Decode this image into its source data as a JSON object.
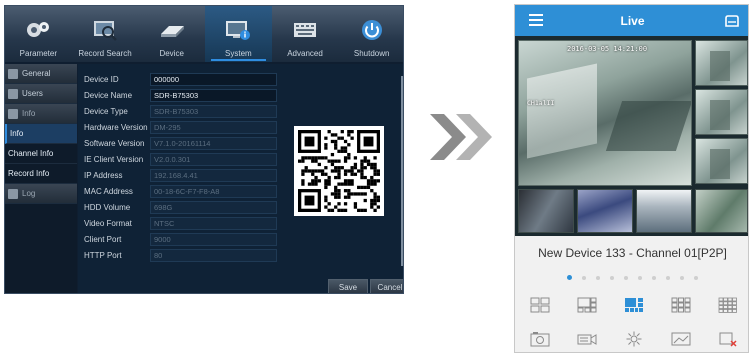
{
  "dvr": {
    "tabs": [
      {
        "label": "Parameter",
        "icon": "gears-icon"
      },
      {
        "label": "Record Search",
        "icon": "magnifier-video-icon"
      },
      {
        "label": "Device",
        "icon": "hard-drive-icon"
      },
      {
        "label": "System",
        "icon": "monitor-info-icon",
        "active": true
      },
      {
        "label": "Advanced",
        "icon": "keyboard-icon"
      },
      {
        "label": "Shutdown",
        "icon": "power-icon"
      }
    ],
    "sidebar": {
      "general": "General",
      "users": "Users",
      "info_group": "Info",
      "info": "Info",
      "channel_info": "Channel Info",
      "record_info": "Record Info",
      "log": "Log"
    },
    "info_rows": [
      {
        "label": "Device ID",
        "value": "000000"
      },
      {
        "label": "Device Name",
        "value": "SDR-B75303"
      },
      {
        "label": "Device Type",
        "value": "SDR-B75303"
      },
      {
        "label": "Hardware Version",
        "value": "DM-295"
      },
      {
        "label": "Software Version",
        "value": "V7.1.0-20161114"
      },
      {
        "label": "IE Client Version",
        "value": "V2.0.0.301"
      },
      {
        "label": "IP Address",
        "value": "192.168.4.41"
      },
      {
        "label": "MAC Address",
        "value": "00-18-6C-F7-F8-A8"
      },
      {
        "label": "HDD Volume",
        "value": "698G"
      },
      {
        "label": "Video Format",
        "value": "NTSC"
      },
      {
        "label": "Client Port",
        "value": "9000"
      },
      {
        "label": "HTTP Port",
        "value": "80"
      }
    ],
    "save_label": "Save",
    "cancel_label": "Cancel"
  },
  "phone": {
    "title": "Live",
    "timestamp": "2016-03-05 14:21:00",
    "camera_label": "CH1alII",
    "device_title": "New Device 133 - Channel 01[P2P]",
    "page_dots": 10,
    "active_dot": 0,
    "accent_color": "#2e8fd6",
    "layout_icons": [
      "single-view-icon",
      "four-split-icon",
      "six-split-icon",
      "nine-split-icon",
      "sixteen-split-icon"
    ],
    "active_layout": "six-split-icon",
    "tool_icons": [
      "snapshot-icon",
      "record-icon",
      "ptz-icon",
      "playback-icon",
      "close-stream-icon"
    ]
  }
}
